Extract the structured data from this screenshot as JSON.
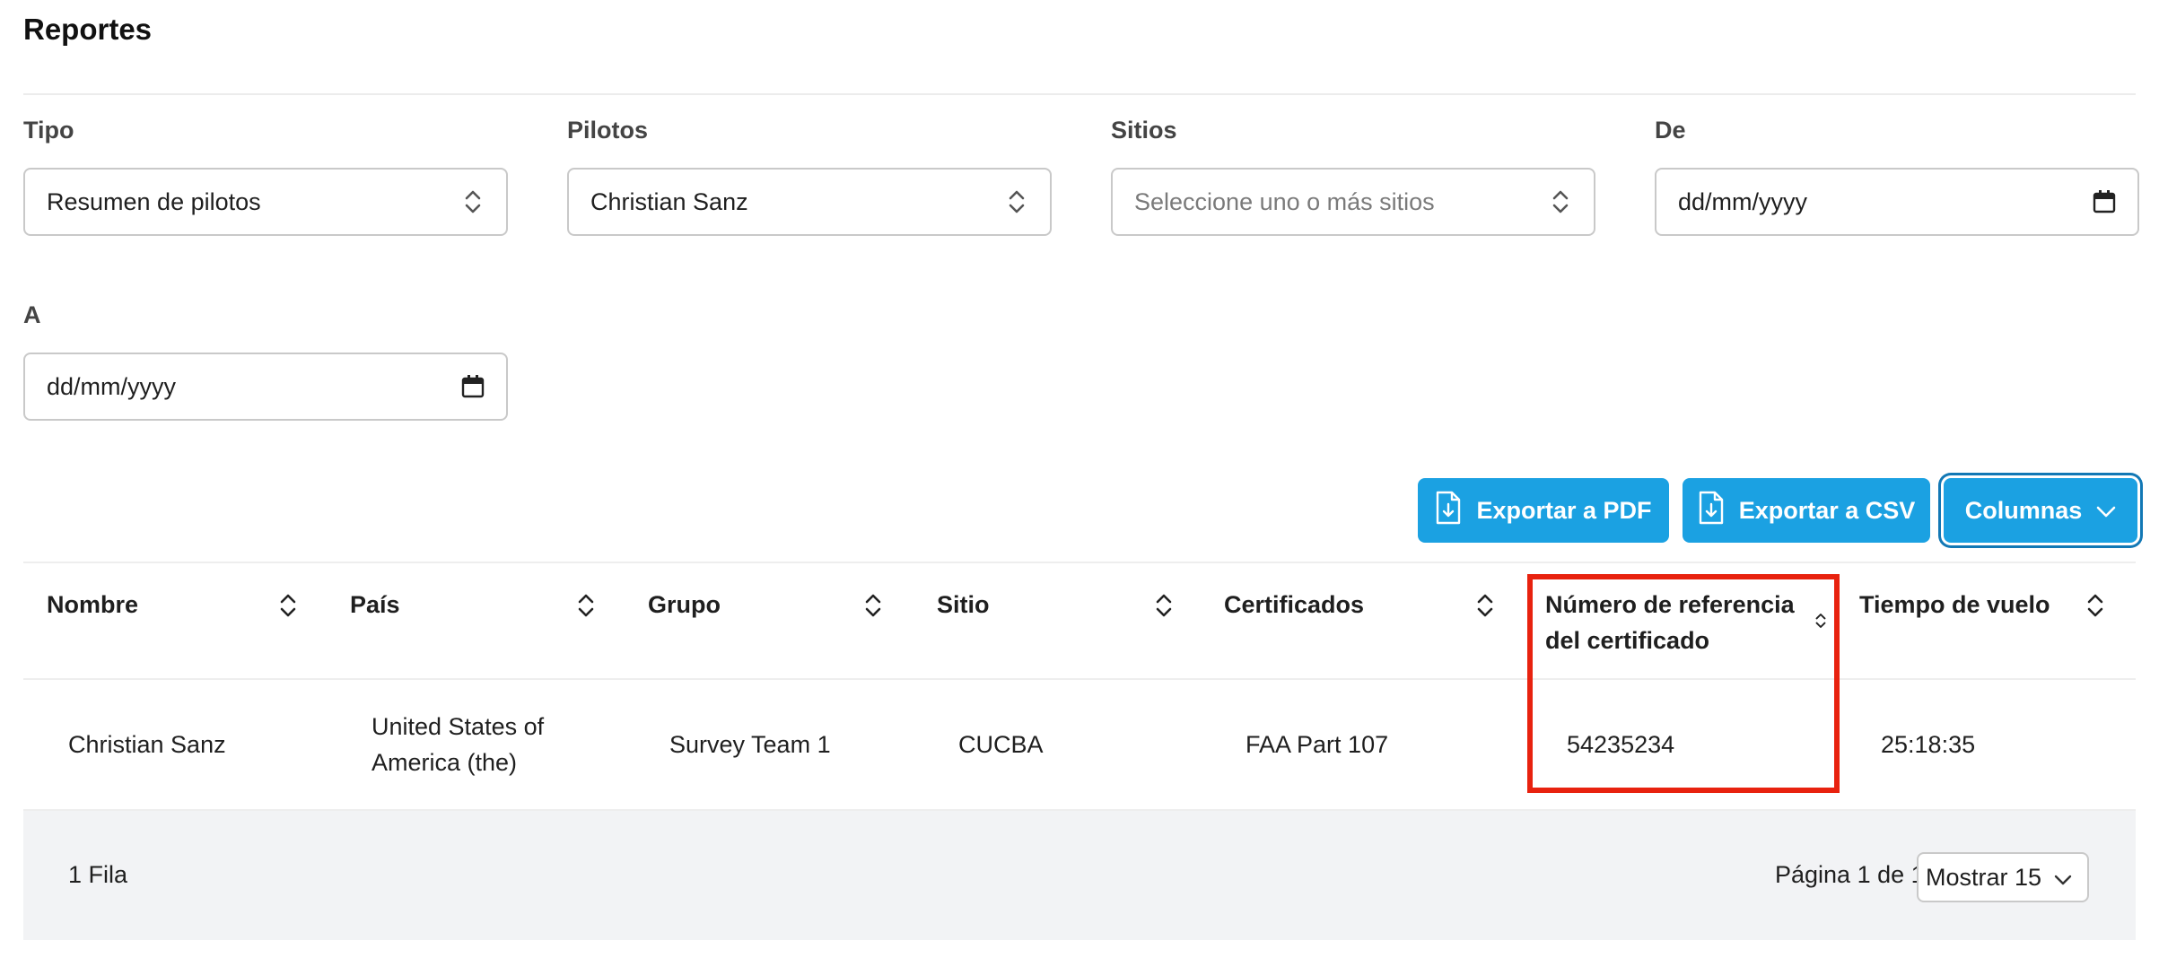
{
  "page": {
    "title": "Reportes"
  },
  "filters": {
    "tipo": {
      "label": "Tipo",
      "value": "Resumen de pilotos"
    },
    "pilotos": {
      "label": "Pilotos",
      "value": "Christian Sanz"
    },
    "sitios": {
      "label": "Sitios",
      "placeholder": "Seleccione uno o más sitios"
    },
    "de": {
      "label": "De",
      "value": "dd/mm/yyyy"
    },
    "a": {
      "label": "A",
      "value": "dd/mm/yyyy"
    }
  },
  "toolbar": {
    "export_pdf": "Exportar a PDF",
    "export_csv": "Exportar a CSV",
    "columns": "Columnas"
  },
  "table": {
    "columns": [
      "Nombre",
      "País",
      "Grupo",
      "Sitio",
      "Certificados",
      "Número de referencia",
      "del certificado",
      "Tiempo de vuelo"
    ],
    "rows": [
      {
        "nombre": "Christian Sanz",
        "pais_line1": "United States of",
        "pais_line2": "America (the)",
        "grupo": "Survey Team 1",
        "sitio": "CUCBA",
        "certificados": "FAA Part 107",
        "numero": "54235234",
        "tiempo": "25:18:35"
      }
    ],
    "footer": {
      "row_count": "1 Fila",
      "pagination": "Página 1 de 1",
      "page_size": "Mostrar 15"
    }
  },
  "colors": {
    "accent": "#1ba1e2",
    "highlight": "#e8220f"
  },
  "icons": [
    "chevron-up-down-icon",
    "calendar-icon",
    "file-download-icon",
    "chevron-down-icon",
    "sort-icon"
  ]
}
